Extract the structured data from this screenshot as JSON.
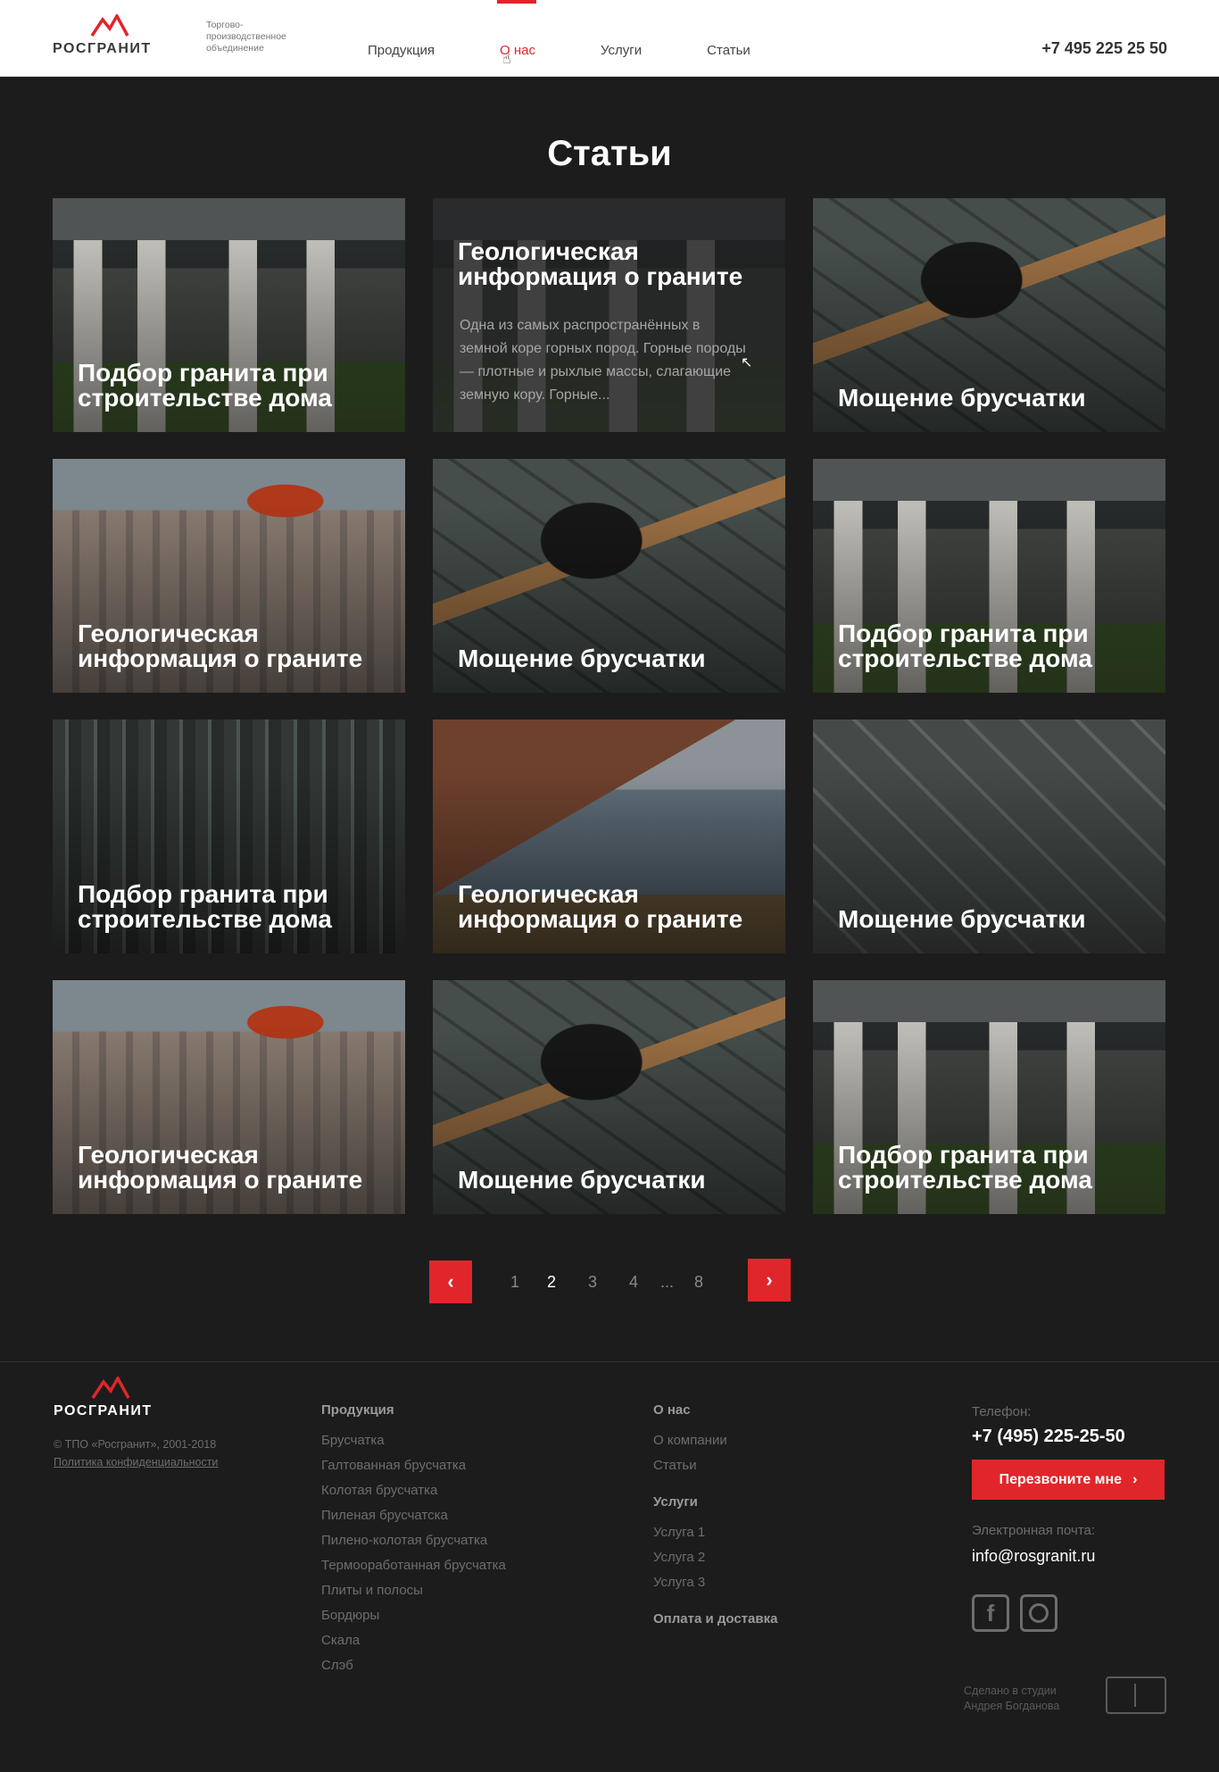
{
  "header": {
    "brand": "РОСГРАНИТ",
    "tagline": "Торгово-производственное объединение",
    "nav": [
      "Продукция",
      "О нас",
      "Услуги",
      "Статьи"
    ],
    "phone": "+7 495 225 25 50"
  },
  "page_title": "Статьи",
  "cards": [
    {
      "title": "Подбор гранита при строительстве дома"
    },
    {
      "title": "Геологическая информация о граните",
      "excerpt": "Одна из самых распространённых в земной коре горных пород. Горные породы — плотные и рыхлые массы, слагающие земную кору. Горные..."
    },
    {
      "title": "Мощение брусчатки"
    },
    {
      "title": "Геологическая информация о граните"
    },
    {
      "title": "Мощение брусчатки"
    },
    {
      "title": "Подбор гранита при строительстве дома"
    },
    {
      "title": "Подбор гранита при строительстве дома"
    },
    {
      "title": "Геологическая информация о граните"
    },
    {
      "title": "Мощение брусчатки"
    },
    {
      "title": "Геологическая информация о граните"
    },
    {
      "title": "Мощение брусчатки"
    },
    {
      "title": "Подбор гранита при строительстве дома"
    }
  ],
  "pagination": {
    "prev": "‹",
    "next": "›",
    "pages": [
      "1",
      "2",
      "3",
      "4",
      "...",
      "8"
    ],
    "current": "2"
  },
  "footer": {
    "brand": "РОСГРАНИТ",
    "copyright": "© ТПО «Росгранит», 2001-2018",
    "policy": "Политика конфиденциальности",
    "products": {
      "heading": "Продукция",
      "links": [
        "Брусчатка",
        "Галтованная брусчатка",
        "Колотая брусчатка",
        "Пиленая брусчатска",
        "Пилено-колотая брусчатка",
        "Термоoработанная брусчатка",
        "Плиты и полосы",
        "Бордюры",
        "Скала",
        "Слэб"
      ]
    },
    "about": {
      "heading": "О нас",
      "links": [
        "О компании",
        "Статьи"
      ]
    },
    "services": {
      "heading": "Услуги",
      "links": [
        "Услуга 1",
        "Услуга 2",
        "Услуга 3"
      ]
    },
    "delivery": "Оплата и доставка",
    "phone_label": "Телефон:",
    "phone": "+7 (495) 225-25-50",
    "callback": "Перезвоните мне",
    "email_label": "Электронная почта:",
    "email": "info@rosgranit.ru",
    "social": [
      "facebook-icon",
      "instagram-icon"
    ],
    "studio_line1": "Сделано в студии",
    "studio_line2": "Андрея Богданова"
  },
  "colors": {
    "accent": "#e0262a",
    "background": "#1c1c1d"
  }
}
